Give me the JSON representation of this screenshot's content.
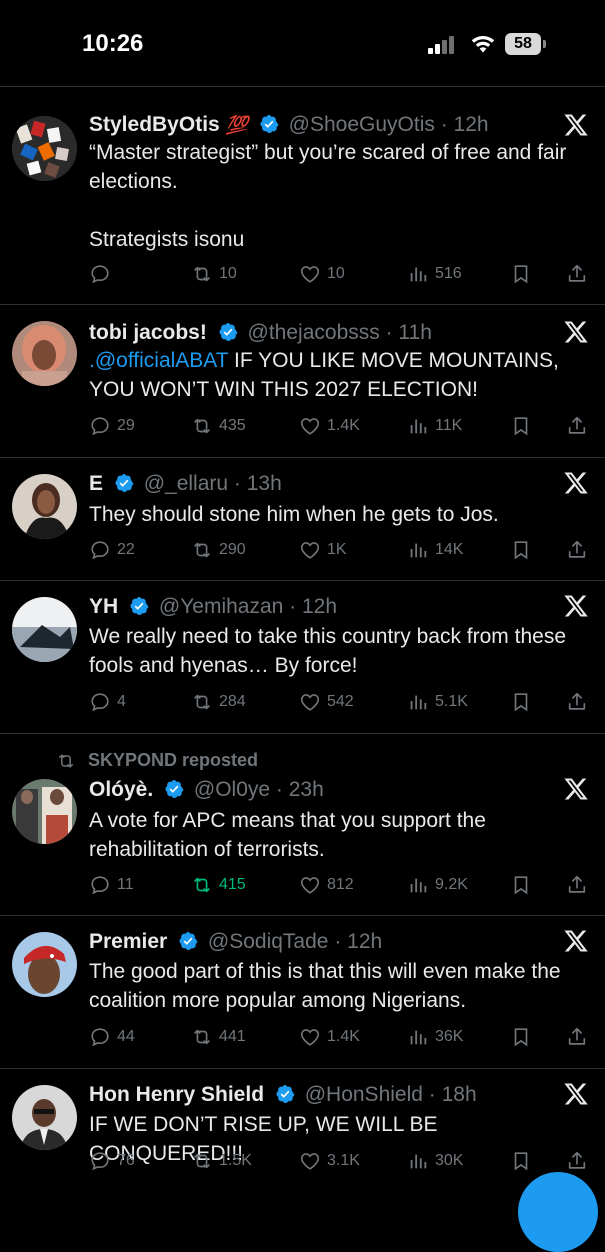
{
  "status": {
    "time": "10:26",
    "battery": "58"
  },
  "tweets": [
    {
      "name": "StyledByOtis",
      "emoji": "💯",
      "handle": "@ShoeGuyOtis",
      "time": "· 12h",
      "text": "“Master strategist” but you’re scared of free and fair elections.\n\nStrategists isonu",
      "replies": "",
      "retweets": "10",
      "likes": "10",
      "views": "516"
    },
    {
      "name": "tobi jacobs!",
      "handle": "@thejacobsss",
      "time": "· 11h",
      "mention": ".@officialABAT",
      "text": " IF YOU LIKE MOVE MOUNTAINS, YOU WON’T WIN THIS 2027 ELECTION!",
      "replies": "29",
      "retweets": "435",
      "likes": "1.4K",
      "views": "11K"
    },
    {
      "name": "E",
      "handle": "@_ellaru",
      "time": "· 13h",
      "text": "They should stone him when he gets to Jos.",
      "replies": "22",
      "retweets": "290",
      "likes": "1K",
      "views": "14K"
    },
    {
      "name": "YH",
      "handle": "@Yemihazan",
      "time": "· 12h",
      "text": "We really need to take this country back from these fools and hyenas… By force!",
      "replies": "4",
      "retweets": "284",
      "likes": "542",
      "views": "5.1K"
    },
    {
      "repost": "SKYPOND reposted",
      "name": "Olóyè.",
      "handle": "@Ol0ye",
      "time": "· 23h",
      "text": "A vote for APC means that you support the rehabilitation of terrorists.",
      "replies": "11",
      "retweets": "415",
      "likes": "812",
      "views": "9.2K"
    },
    {
      "name": "Premier",
      "handle": "@SodiqTade",
      "time": "· 12h",
      "text": "The good part of this is that this will even make the coalition more popular among Nigerians.",
      "replies": "44",
      "retweets": "441",
      "likes": "1.4K",
      "views": "36K"
    },
    {
      "name": "Hon Henry Shield",
      "handle": "@HonShield",
      "time": "· 18h",
      "text": "IF WE DON’T RISE UP, WE WILL BE CONQUERED!!!",
      "replies": "76",
      "retweets": "1.5K",
      "likes": "3.1K",
      "views": "30K"
    }
  ],
  "colors": {
    "accent": "#1d9bf0",
    "muted": "#71767b",
    "retweet_active": "#00ba7c"
  }
}
